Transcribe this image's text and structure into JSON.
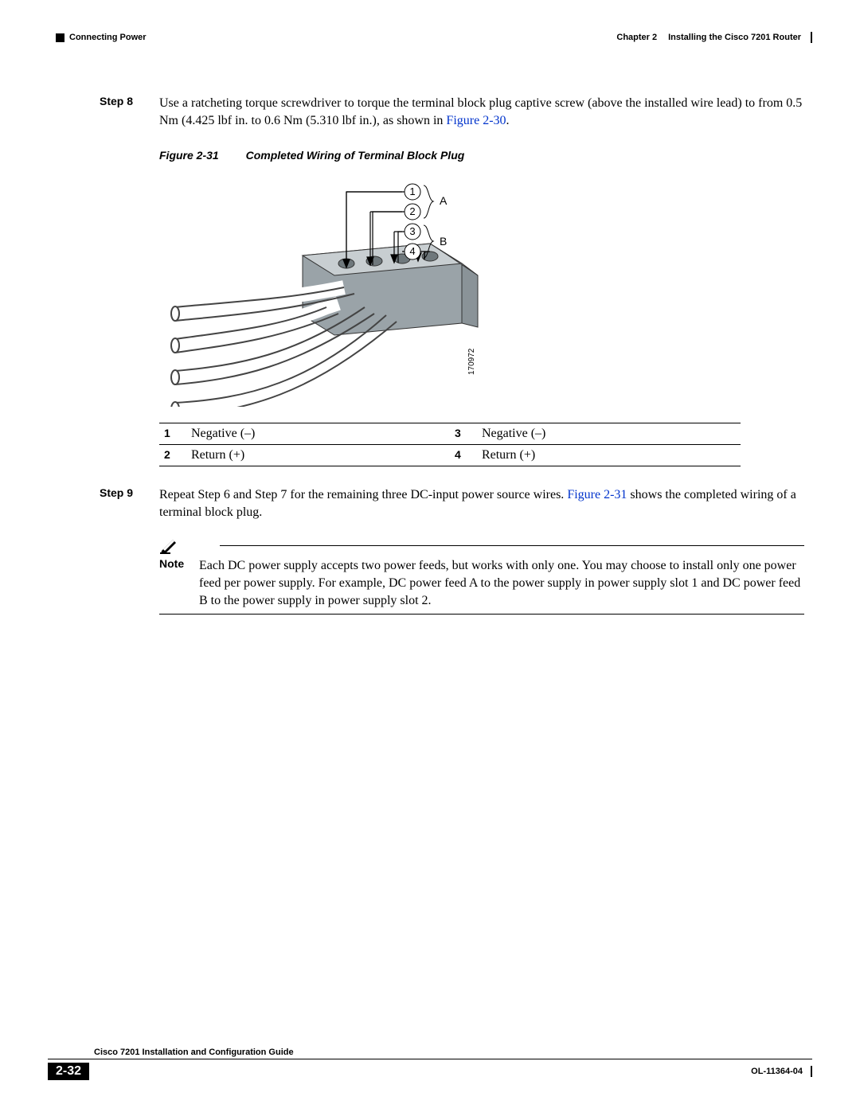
{
  "header": {
    "section": "Connecting Power",
    "chapter_label": "Chapter 2",
    "chapter_title": "Installing the Cisco 7201 Router"
  },
  "step8": {
    "label": "Step 8",
    "text_before_link": "Use a ratcheting torque screwdriver to torque the terminal block plug captive screw (above the installed wire lead) to from 0.5 Nm (4.425 lbf in. to 0.6 Nm (5.310 lbf in.), as shown in ",
    "link": "Figure 2-30",
    "text_after_link": "."
  },
  "figure": {
    "number": "Figure 2-31",
    "title": "Completed Wiring of Terminal Block Plug",
    "callout_A": "A",
    "callout_B": "B",
    "callout_1": "1",
    "callout_2": "2",
    "callout_3": "3",
    "callout_4": "4",
    "image_id": "170972"
  },
  "legend": {
    "r1c1n": "1",
    "r1c1t": "Negative (–)",
    "r1c2n": "3",
    "r1c2t": "Negative (–)",
    "r2c1n": "2",
    "r2c1t": "Return (+)",
    "r2c2n": "4",
    "r2c2t": "Return (+)"
  },
  "step9": {
    "label": "Step 9",
    "text_before_link": "Repeat Step 6 and Step 7 for the remaining three DC-input power source wires. ",
    "link": "Figure 2-31",
    "text_after_link": " shows the completed wiring of a terminal block plug."
  },
  "note": {
    "label": "Note",
    "text": "Each DC power supply accepts two power feeds, but works with only one. You may choose to install only one power feed per power supply. For example, DC power feed A to the power supply in power supply slot 1 and DC power feed B to the power supply in power supply slot 2."
  },
  "footer": {
    "guide": "Cisco 7201 Installation and Configuration Guide",
    "page": "2-32",
    "doc": "OL-11364-04"
  }
}
